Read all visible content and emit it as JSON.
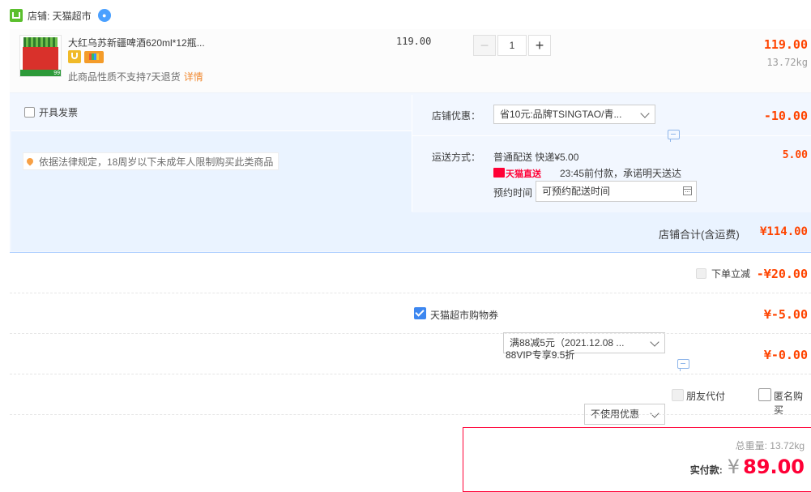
{
  "shop": {
    "label": "店铺: 天猫超市",
    "chat_icon": "ww-icon"
  },
  "item": {
    "title": "大红乌苏新疆啤酒620ml*12瓶...",
    "thumb_badge": "99",
    "note": "此商品性质不支持7天退货",
    "note_link": "详情",
    "unit_price": "119.00",
    "quantity": "1",
    "minus": "−",
    "plus": "+",
    "total": "119.00",
    "weight": "13.72kg"
  },
  "invoice": {
    "label": "开具发票"
  },
  "legal_notice": "依据法律规定，18周岁以下未成年人限制购买此类商品",
  "shop_discount": {
    "label": "店铺优惠：",
    "selected": "省10元:品牌TSINGTAO/青...",
    "amount": "-10.00"
  },
  "shipping": {
    "label": "运送方式：",
    "method": "普通配送 快递¥5.00",
    "badge": "天猫直送",
    "promise": "23:45前付款，承诺明天送达",
    "reserve_label": "预约时间",
    "reserve_value": "可预约配送时间",
    "amount": "5.00"
  },
  "shop_total": {
    "label": "店铺合计(含运费)",
    "amount": "¥114.00"
  },
  "order_discount": {
    "label": "下单立减",
    "amount": "-¥20.00"
  },
  "coupon": {
    "label": "天猫超市购物券",
    "selected": "满88减5元（2021.12.08 ...",
    "amount": "¥-5.00"
  },
  "vip": {
    "label": "88VIP专享9.5折",
    "selected": "不使用优惠",
    "amount": "¥-0.00"
  },
  "extras": {
    "friend_pay": "朋友代付",
    "anonymous": "匿名购买"
  },
  "payment": {
    "weight_label": "总重量: 13.72kg",
    "label": "实付款:",
    "currency": "¥",
    "amount": "89.00"
  },
  "colors": {
    "accent_red": "#ff0036",
    "price_red": "#ff4400",
    "panel_blue": "#f2f7ff",
    "checkbox_blue": "#3d87f0"
  }
}
